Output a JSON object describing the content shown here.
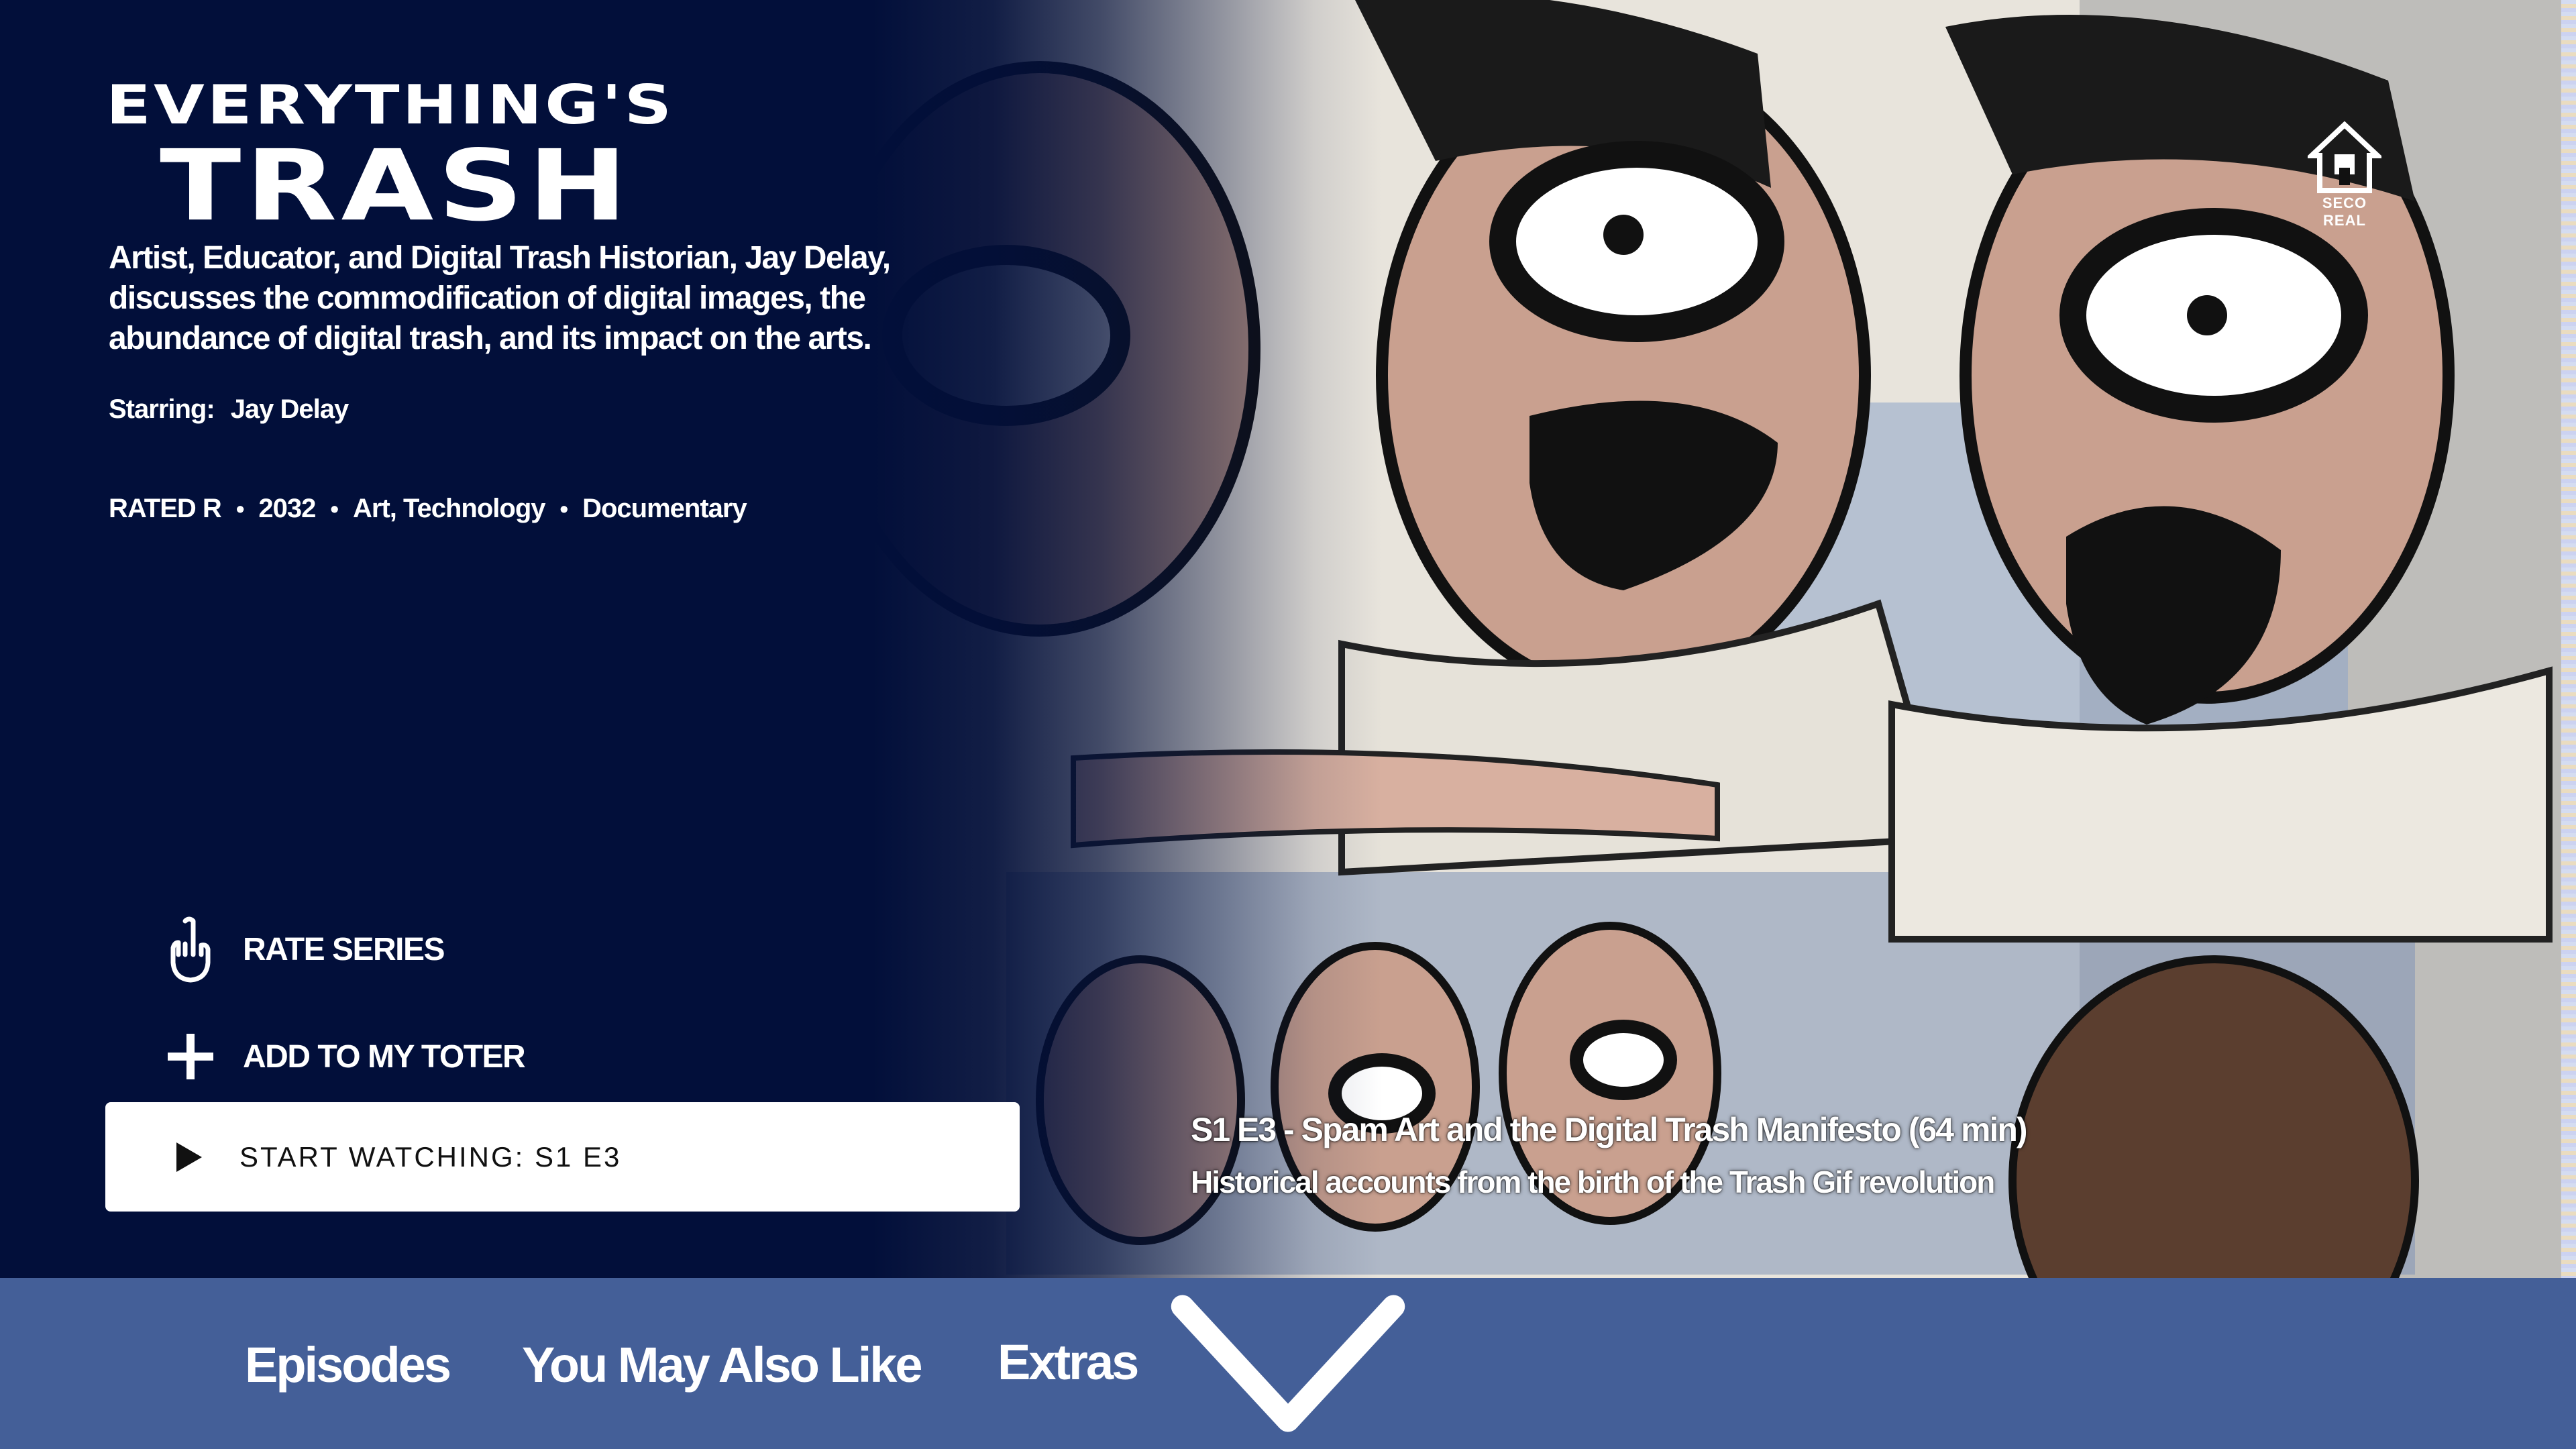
{
  "show": {
    "title_line1": "EVERYTHING'S",
    "title_line2": "TRASH",
    "description": "Artist, Educator, and Digital Trash Historian, Jay Delay, discusses the commodification of digital images, the abundance of digital trash, and its impact on the arts.",
    "starring_label": "Starring:",
    "starring_value": "Jay Delay",
    "rating": "RATED R",
    "year": "2032",
    "genres": "Art, Technology",
    "type": "Documentary",
    "meta_separator": "•"
  },
  "network": {
    "label_line1": "SECO",
    "label_line2": "REAL",
    "icon": "house-logo-icon"
  },
  "actions": {
    "rate_label": "RATE SERIES",
    "rate_icon": "hand-gesture-icon",
    "toter_label": "ADD TO MY TOTER",
    "toter_icon": "plus-icon",
    "start_label": "START WATCHING: S1 E3",
    "start_icon": "play-icon"
  },
  "episode": {
    "title": "S1 E3 - Spam Art and the Digital Trash Manifesto (64 min)",
    "subtitle": "Historical accounts from the birth of the Trash Gif revolution"
  },
  "tabs": {
    "collapse_icon": "chevron-down-icon",
    "items": [
      "Episodes",
      "You May Also Like",
      "Extras"
    ]
  },
  "colors": {
    "background": "#020f3a",
    "tab_bar": "#445f98",
    "button_bg": "#ffffff",
    "button_text": "#111111"
  }
}
